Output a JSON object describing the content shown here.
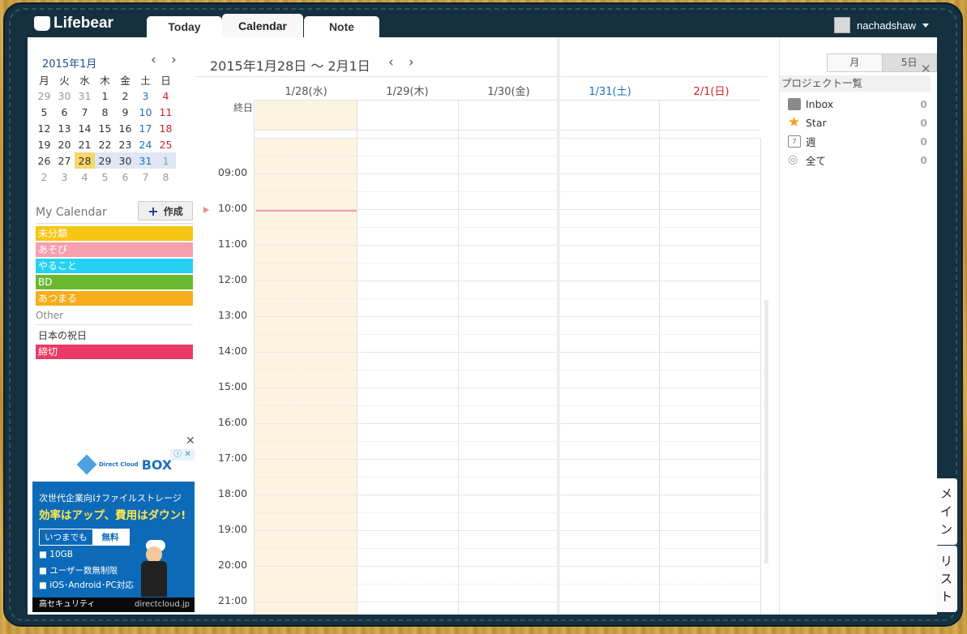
{
  "app": {
    "logo": "Lifebear"
  },
  "nav": {
    "tabs": [
      "Today",
      "Calendar",
      "Note"
    ]
  },
  "user": {
    "name": "nachadshaw"
  },
  "mini": {
    "title": "2015年1月",
    "prev": "‹",
    "next": "›",
    "weekdays": [
      "月",
      "火",
      "水",
      "木",
      "金",
      "土",
      "日"
    ],
    "weeks": [
      [
        "29",
        "30",
        "31",
        "1",
        "2",
        "3",
        "4"
      ],
      [
        "5",
        "6",
        "7",
        "8",
        "9",
        "10",
        "11"
      ],
      [
        "12",
        "13",
        "14",
        "15",
        "16",
        "17",
        "18"
      ],
      [
        "19",
        "20",
        "21",
        "22",
        "23",
        "24",
        "25"
      ],
      [
        "26",
        "27",
        "28",
        "29",
        "30",
        "31",
        "1"
      ],
      [
        "2",
        "3",
        "4",
        "5",
        "6",
        "7",
        "8"
      ]
    ]
  },
  "mycal": {
    "title": "My Calendar",
    "create": "作成",
    "cats": [
      {
        "label": "未分類",
        "color": "#f7c513"
      },
      {
        "label": "あそび",
        "color": "#f79fae"
      },
      {
        "label": "やること",
        "color": "#25d1f2"
      },
      {
        "label": "BD",
        "color": "#6ab82f"
      },
      {
        "label": "あつまる",
        "color": "#f6ae1b"
      }
    ],
    "other": "Other",
    "holiday": "日本の祝日",
    "deadline": {
      "label": "締切",
      "color": "#e93b66"
    }
  },
  "ad": {
    "brand": "BOX",
    "brand_small": "Direct Cloud",
    "line1": "次世代企業向けファイルストレージ",
    "line2": "効率はアップ、費用はダウン!",
    "badge1": "いつまでも",
    "badge2": "無料",
    "bullets": [
      "■ 10GB",
      "■ ユーザー数無制限",
      "■ iOS･Android･PC対応"
    ],
    "foot": "高セキュリティ",
    "domain": "directcloud.jp",
    "info": "ⓘ ✕",
    "close": "✕"
  },
  "cal": {
    "range": "2015年1月28日 〜 2月1日",
    "prev": "‹",
    "next": "›",
    "days": [
      {
        "label": "1/28(水)",
        "type": "wd"
      },
      {
        "label": "1/29(木)",
        "type": "wd"
      },
      {
        "label": "1/30(金)",
        "type": "wd"
      },
      {
        "label": "1/31(土)",
        "type": "sat"
      },
      {
        "label": "2/1(日)",
        "type": "sun"
      }
    ],
    "allday": "終日",
    "hours": [
      "09:00",
      "10:00",
      "11:00",
      "12:00",
      "13:00",
      "14:00",
      "15:00",
      "16:00",
      "17:00",
      "18:00",
      "19:00",
      "20:00",
      "21:00"
    ],
    "views": [
      "月",
      "5日"
    ]
  },
  "projects": {
    "title": "プロジェクト一覧",
    "close": "✕",
    "items": [
      {
        "label": "Inbox",
        "count": "0",
        "icon": "inbox-icon"
      },
      {
        "label": "Star",
        "count": "0",
        "icon": "star-icon"
      },
      {
        "label": "週",
        "count": "0",
        "icon": "week-icon"
      },
      {
        "label": "全て",
        "count": "0",
        "icon": "all-icon"
      }
    ]
  },
  "sidetabs": [
    "メイン",
    "リスト"
  ]
}
